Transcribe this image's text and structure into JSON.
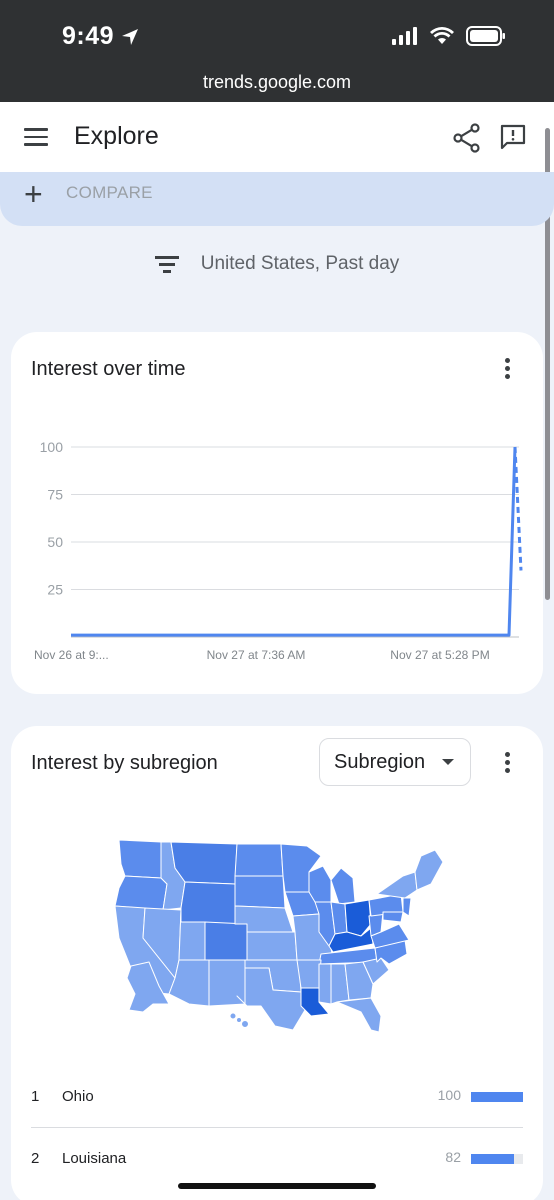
{
  "status_bar": {
    "time": "9:49"
  },
  "browser": {
    "url": "trends.google.com"
  },
  "app_bar": {
    "title": "Explore"
  },
  "compare": {
    "label": "COMPARE"
  },
  "filter": {
    "text": "United States, Past day"
  },
  "interest_over_time": {
    "title": "Interest over time",
    "chart_data": {
      "type": "line",
      "y_ticks": [
        "100",
        "75",
        "50",
        "25"
      ],
      "x_tick_labels": [
        "Nov 26 at 9:...",
        "Nov 27 at 7:36 AM",
        "Nov 27 at 5:28 PM"
      ],
      "ylim": [
        0,
        100
      ],
      "series": [
        {
          "values": [
            1,
            1,
            1,
            1,
            1,
            1,
            1,
            1,
            1,
            1,
            1,
            1,
            1,
            1,
            1,
            1,
            1,
            1,
            1,
            1,
            100
          ]
        }
      ],
      "partial_segment": {
        "from": 100,
        "to": 35
      },
      "grid": true,
      "line_color": "#4f86ef"
    }
  },
  "interest_by_subregion": {
    "title": "Interest by subregion",
    "selector": "Subregion",
    "list": [
      {
        "rank": "1",
        "name": "Ohio",
        "value": 100
      },
      {
        "rank": "2",
        "name": "Louisiana",
        "value": 82
      }
    ]
  },
  "colors": {
    "accent": "#4f86ef",
    "map_light": "#7fa7f0",
    "map_mid": "#5b8ced",
    "map_dark": "#4a7ee6",
    "map_darkest": "#1a5cd8"
  }
}
